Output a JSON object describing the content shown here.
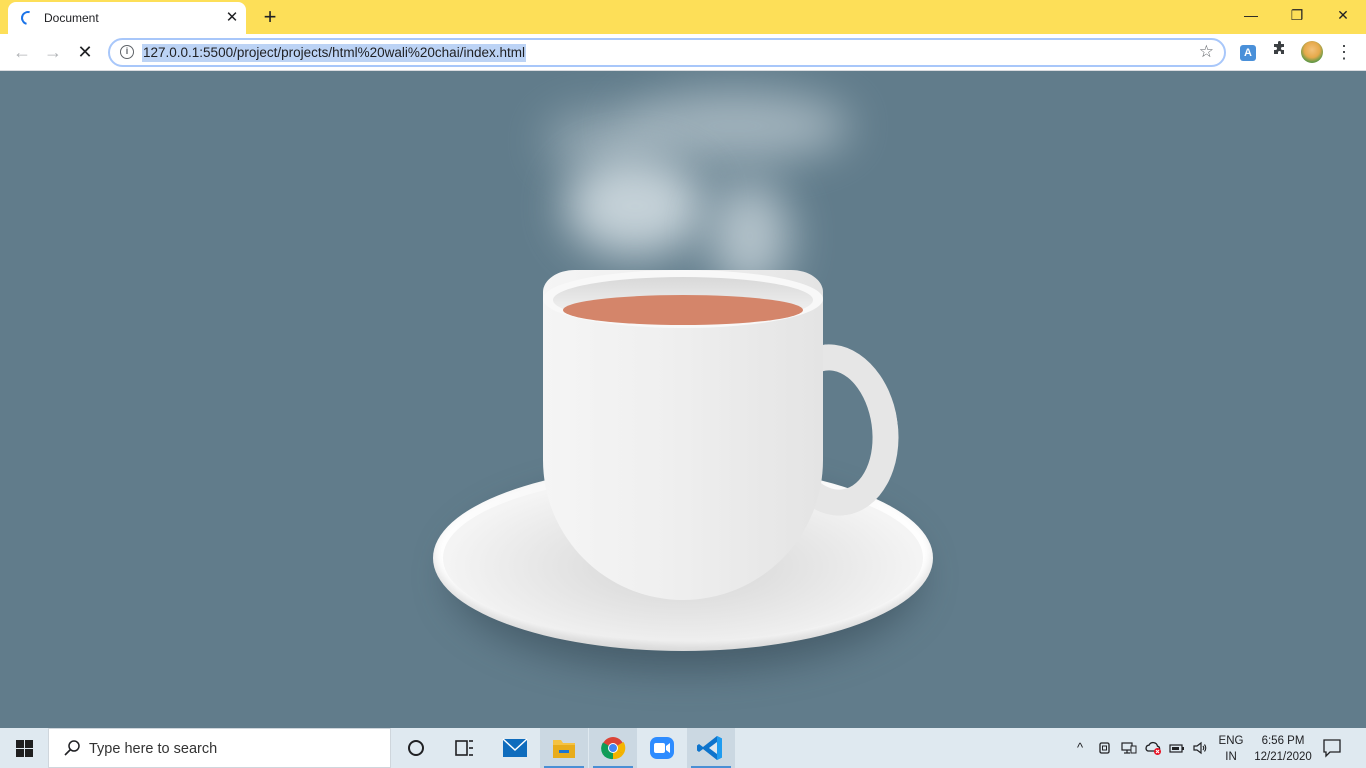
{
  "browser": {
    "tab": {
      "title": "Document",
      "close_glyph": "✕"
    },
    "new_tab_glyph": "+",
    "window_controls": {
      "minimize": "—",
      "restore": "❐",
      "close": "✕"
    },
    "nav": {
      "back": "←",
      "forward": "→",
      "stop": "✕"
    },
    "url": "127.0.0.1:5500/project/projects/html%20wali%20chai/index.html",
    "icons": [
      "info-icon",
      "star-icon",
      "extension-a-icon",
      "puzzle-icon",
      "profile-avatar",
      "menu-dots-icon"
    ],
    "extension_a_label": "A",
    "menu_glyph": "⋮",
    "colors": {
      "title_bar": "#fddf58",
      "omnibox_border": "#a8c7fa",
      "url_highlight": "#bcd3f5"
    }
  },
  "page": {
    "background": "#617c8b",
    "illustration": [
      "steam",
      "cup",
      "tea",
      "handle",
      "saucer"
    ],
    "colors": {
      "tea": "#d4856a",
      "cup": "#efefef",
      "saucer": "#f4f4f4",
      "steam": "#d7e1e6"
    }
  },
  "taskbar": {
    "search_placeholder": "Type here to search",
    "apps": [
      "cortana-icon",
      "task-view-icon",
      "mail-icon",
      "file-explorer-icon",
      "chrome-icon",
      "zoom-icon",
      "vscode-icon"
    ],
    "active_apps": [
      "file-explorer-icon",
      "chrome-icon",
      "vscode-icon"
    ],
    "tray": {
      "chevron": "^",
      "language_line1": "ENG",
      "language_line2": "IN",
      "time": "6:56 PM",
      "date": "12/21/2020"
    },
    "colors": {
      "background": "#dfe9f0",
      "active_indicator": "#4a8fd4"
    }
  }
}
